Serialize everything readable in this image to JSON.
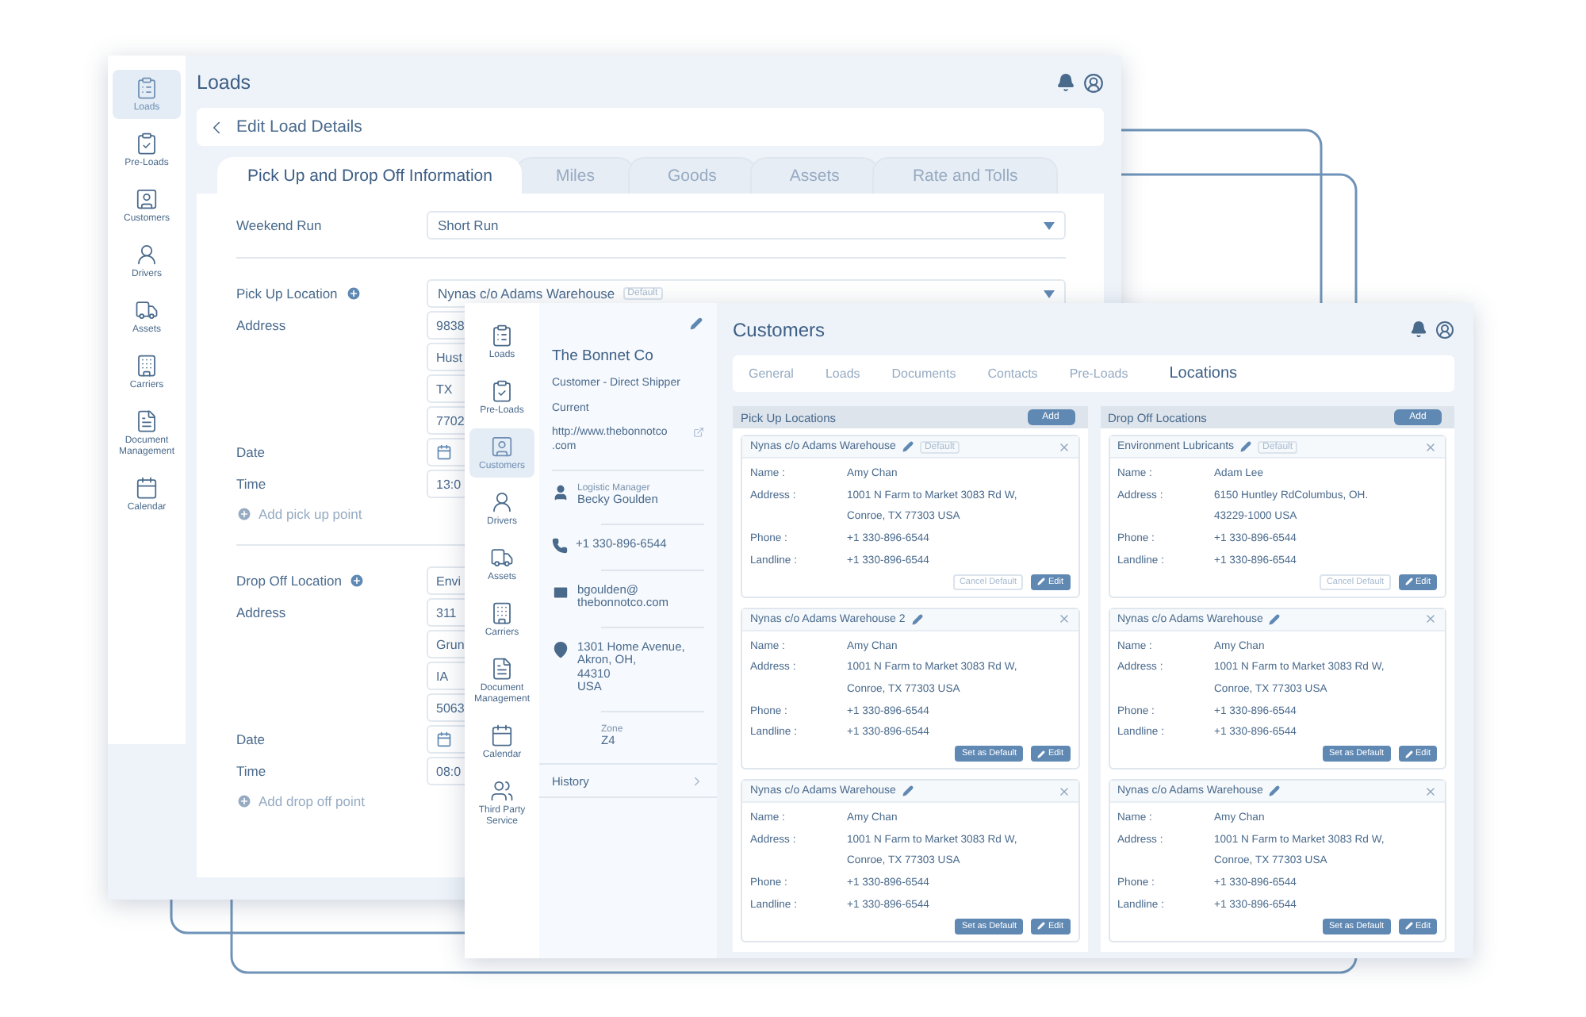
{
  "loads_window": {
    "title": "Loads",
    "nav": [
      {
        "label": "Loads",
        "selected": true
      },
      {
        "label": "Pre-Loads",
        "selected": false
      },
      {
        "label": "Customers",
        "selected": false
      },
      {
        "label": "Drivers",
        "selected": false
      },
      {
        "label": "Assets",
        "selected": false
      },
      {
        "label": "Carriers",
        "selected": false
      },
      {
        "label": "Document Management",
        "selected": false
      },
      {
        "label": "Calendar",
        "selected": false
      }
    ],
    "back_label": "Edit Load Details",
    "tabs": [
      {
        "label": "Pick Up and Drop Off Information",
        "selected": true
      },
      {
        "label": "Miles",
        "selected": false
      },
      {
        "label": "Goods",
        "selected": false
      },
      {
        "label": "Assets",
        "selected": false
      },
      {
        "label": "Rate and Tolls",
        "selected": false
      }
    ],
    "weekend_run": {
      "label": "Weekend Run",
      "value": "Short Run"
    },
    "sections": [
      {
        "label": "Pick Up Location",
        "value": "Nynas c/o Adams Warehouse",
        "badge": "Default",
        "address_label": "Address",
        "address_fields": [
          "9838",
          "Hust",
          "TX",
          "7702"
        ],
        "date_label": "Date",
        "time_label": "Time",
        "time_value": "13:0",
        "add_point": "Add pick up point"
      },
      {
        "label": "Drop Off Location",
        "value": "Envi",
        "address_label": "Address",
        "address_fields": [
          "311",
          "Grun",
          "IA",
          "5063"
        ],
        "date_label": "Date",
        "time_label": "Time",
        "time_value": "08:0",
        "add_point": "Add drop off point"
      }
    ]
  },
  "customers_window": {
    "nav": [
      {
        "label": "Loads",
        "selected": false
      },
      {
        "label": "Pre-Loads",
        "selected": false
      },
      {
        "label": "Customers",
        "selected": true
      },
      {
        "label": "Drivers",
        "selected": false
      },
      {
        "label": "Assets",
        "selected": false
      },
      {
        "label": "Carriers",
        "selected": false
      },
      {
        "label": "Document Management",
        "selected": false
      },
      {
        "label": "Calendar",
        "selected": false
      },
      {
        "label": "Third Party Service",
        "selected": false
      }
    ],
    "profile": {
      "name": "The Bonnet Co",
      "type": "Customer - Direct Shipper",
      "status": "Current",
      "website": [
        "http://www.thebonnotco",
        ".com"
      ],
      "contact_role": "Logistic Manager",
      "contact_name": "Becky Goulden",
      "phone": "+1 330-896-6544",
      "email": [
        "bgoulden@",
        "thebonnotco.com"
      ],
      "address": [
        "1301 Home Avenue,",
        "Akron, OH,",
        "44310",
        "USA"
      ],
      "zone_label": "Zone",
      "zone": "Z4",
      "history": "History"
    },
    "title": "Customers",
    "tabs": [
      {
        "label": "General",
        "selected": false
      },
      {
        "label": "Loads",
        "selected": false
      },
      {
        "label": "Documents",
        "selected": false
      },
      {
        "label": "Contacts",
        "selected": false
      },
      {
        "label": "Pre-Loads",
        "selected": false
      },
      {
        "label": "Locations",
        "selected": true
      }
    ],
    "columns": [
      {
        "title": "Pick Up Locations",
        "add": "Add",
        "cards": [
          {
            "title": "Nynas c/o Adams Warehouse",
            "badge": "Default",
            "fields": [
              {
                "label": "Name :",
                "lines": [
                  "Amy Chan"
                ]
              },
              {
                "label": "Address :",
                "lines": [
                  "1001 N Farm to Market 3083 Rd W,",
                  "Conroe, TX 77303 USA"
                ]
              },
              {
                "label": "Phone :",
                "lines": [
                  "+1 330-896-6544"
                ]
              },
              {
                "label": "Landline :",
                "lines": [
                  "+1 330-896-6544"
                ]
              }
            ],
            "buttons": [
              {
                "label": "Cancel Default",
                "kind": "outline"
              },
              {
                "label": "Edit",
                "kind": "edit"
              }
            ]
          },
          {
            "title": "Nynas c/o Adams Warehouse 2",
            "fields": [
              {
                "label": "Name :",
                "lines": [
                  "Amy Chan"
                ]
              },
              {
                "label": "Address :",
                "lines": [
                  "1001 N Farm to Market 3083 Rd W,",
                  "Conroe, TX 77303 USA"
                ]
              },
              {
                "label": "Phone :",
                "lines": [
                  "+1 330-896-6544"
                ]
              },
              {
                "label": "Landline :",
                "lines": [
                  "+1 330-896-6544"
                ]
              }
            ],
            "buttons": [
              {
                "label": "Set as Default",
                "kind": "filled"
              },
              {
                "label": "Edit",
                "kind": "edit"
              }
            ]
          },
          {
            "title": "Nynas c/o Adams Warehouse",
            "fields": [
              {
                "label": "Name :",
                "lines": [
                  "Amy Chan"
                ]
              },
              {
                "label": "Address :",
                "lines": [
                  "1001 N Farm to Market 3083 Rd W,",
                  "Conroe, TX 77303 USA"
                ]
              },
              {
                "label": "Phone :",
                "lines": [
                  "+1 330-896-6544"
                ]
              },
              {
                "label": "Landline :",
                "lines": [
                  "+1 330-896-6544"
                ]
              }
            ],
            "buttons": [
              {
                "label": "Set as Default",
                "kind": "filled"
              },
              {
                "label": "Edit",
                "kind": "edit"
              }
            ]
          }
        ]
      },
      {
        "title": "Drop Off Locations",
        "add": "Add",
        "cards": [
          {
            "title": "Environment Lubricants",
            "badge": "Default",
            "fields": [
              {
                "label": "Name :",
                "lines": [
                  "Adam Lee"
                ]
              },
              {
                "label": "Address :",
                "lines": [
                  "6150 Huntley RdColumbus, OH.",
                  "43229-1000 USA"
                ]
              },
              {
                "label": "Phone :",
                "lines": [
                  "+1 330-896-6544"
                ]
              },
              {
                "label": "Landline :",
                "lines": [
                  "+1 330-896-6544"
                ]
              }
            ],
            "buttons": [
              {
                "label": "Cancel Default",
                "kind": "outline"
              },
              {
                "label": "Edit",
                "kind": "edit"
              }
            ]
          },
          {
            "title": "Nynas c/o Adams Warehouse",
            "fields": [
              {
                "label": "Name :",
                "lines": [
                  "Amy Chan"
                ]
              },
              {
                "label": "Address :",
                "lines": [
                  "1001 N Farm to Market 3083 Rd W,",
                  "Conroe, TX 77303 USA"
                ]
              },
              {
                "label": "Phone :",
                "lines": [
                  "+1 330-896-6544"
                ]
              },
              {
                "label": "Landline :",
                "lines": [
                  "+1 330-896-6544"
                ]
              }
            ],
            "buttons": [
              {
                "label": "Set as Default",
                "kind": "filled"
              },
              {
                "label": "Edit",
                "kind": "edit"
              }
            ]
          },
          {
            "title": "Nynas c/o Adams Warehouse",
            "fields": [
              {
                "label": "Name :",
                "lines": [
                  "Amy Chan"
                ]
              },
              {
                "label": "Address :",
                "lines": [
                  "1001 N Farm to Market 3083 Rd W,",
                  "Conroe, TX 77303 USA"
                ]
              },
              {
                "label": "Phone :",
                "lines": [
                  "+1 330-896-6544"
                ]
              },
              {
                "label": "Landline :",
                "lines": [
                  "+1 330-896-6544"
                ]
              }
            ],
            "buttons": [
              {
                "label": "Set as Default",
                "kind": "filled"
              },
              {
                "label": "Edit",
                "kind": "edit"
              }
            ]
          }
        ]
      }
    ]
  }
}
